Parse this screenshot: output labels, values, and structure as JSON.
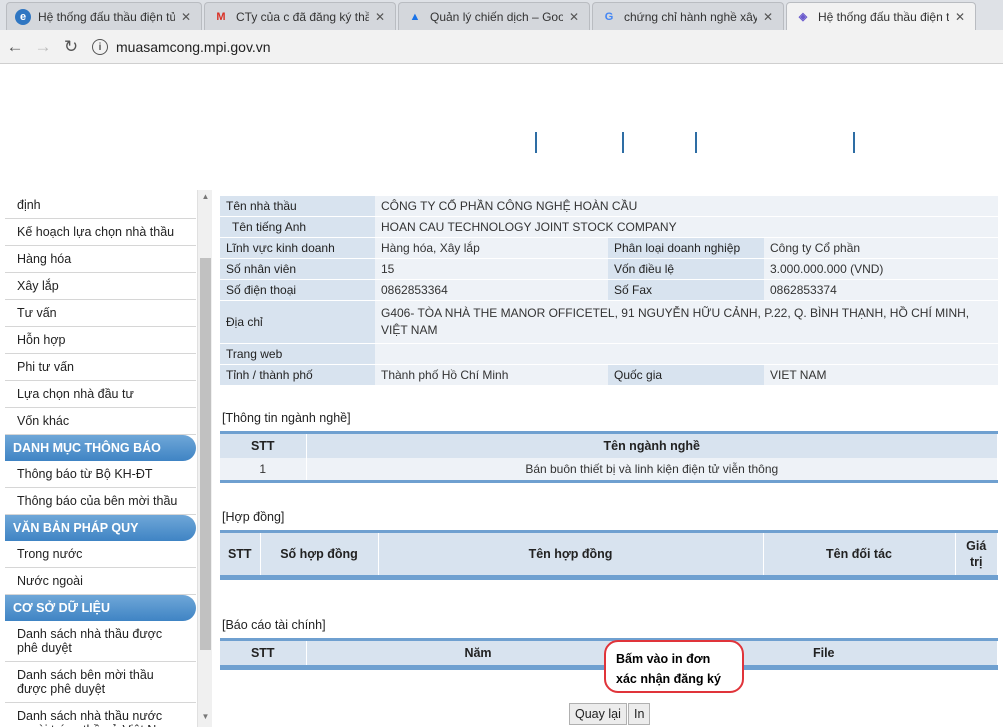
{
  "browser": {
    "tabs": [
      {
        "title": "Hệ thống đấu thầu điện tử",
        "icon": "ie-icon"
      },
      {
        "title": "CTy của c đã đăng ký thầu",
        "icon": "gmail-icon"
      },
      {
        "title": "Quản lý chiến dịch – Google",
        "icon": "google-ads-icon"
      },
      {
        "title": "chứng chỉ hành nghề xây dựng",
        "icon": "google-icon"
      },
      {
        "title": "Hệ thống đấu thầu điện tử",
        "icon": "muasamcong-icon"
      }
    ],
    "url": "muasamcong.mpi.gov.vn"
  },
  "sidebar": {
    "items_top": [
      "định",
      "Kế hoạch lựa chọn nhà thầu",
      "Hàng hóa",
      "Xây lắp",
      "Tư vấn",
      "Hỗn hợp",
      "Phi tư vấn",
      "Lựa chọn nhà đầu tư",
      "Vốn khác"
    ],
    "head_thongbao": "DANH MỤC THÔNG BÁO",
    "items_thongbao": [
      "Thông báo từ Bộ KH-ĐT",
      "Thông báo của bên mời thầu"
    ],
    "head_vanban": "VĂN BẢN PHÁP QUY",
    "items_vanban": [
      "Trong nước",
      "Nước ngoài"
    ],
    "head_csdl": "CƠ SỞ DỮ LIỆU",
    "items_csdl": [
      "Danh sách nhà thầu được phê duyệt",
      "Danh sách bên mời thầu được phê duyệt",
      "Danh sách nhà thầu nước ngoài trúng thầu ở Việt Nam"
    ]
  },
  "company": {
    "name_label": "Tên nhà thầu",
    "name": "CÔNG TY CỔ PHẦN CÔNG NGHỆ HOÀN CẦU",
    "en_label": "Tên tiếng Anh",
    "en_name": "HOAN CAU TECHNOLOGY JOINT STOCK COMPANY",
    "field_label": "Lĩnh vực kinh doanh",
    "field": "Hàng hóa, Xây lắp",
    "type_label": "Phân loại doanh nghiệp",
    "type": "Công ty Cổ phần",
    "staff_label": "Số nhân viên",
    "staff": "15",
    "capital_label": "Vốn điều lệ",
    "capital": "3.000.000.000 (VND)",
    "phone_label": "Số điện thoại",
    "phone": "0862853364",
    "fax_label": "Số Fax",
    "fax": "0862853374",
    "address_label": "Địa chỉ",
    "address": "G406- TÒA NHÀ THE MANOR OFFICETEL, 91 NGUYỄN HỮU CẢNH, P.22, Q. BÌNH THẠNH, HỒ CHÍ MINH, VIỆT NAM",
    "web_label": "Trang web",
    "web": "",
    "province_label": "Tỉnh / thành phố",
    "province": "Thành phố Hồ Chí Minh",
    "country_label": "Quốc gia",
    "country": "VIET NAM"
  },
  "industry": {
    "title": "[Thông tin ngành nghề]",
    "headers": [
      "STT",
      "Tên ngành nghề"
    ],
    "rows": [
      [
        "1",
        "Bán buôn thiết bị và linh kiện điện tử viễn thông"
      ]
    ]
  },
  "contracts": {
    "title": "[Hợp đồng]",
    "headers": [
      "STT",
      "Số hợp đồng",
      "Tên hợp đồng",
      "Tên đối tác",
      "Giá trị"
    ]
  },
  "finance": {
    "title": "[Báo cáo tài chính]",
    "headers": [
      "STT",
      "Năm",
      "File"
    ]
  },
  "callout": "Bấm vào in đơn xác nhận đăng ký",
  "buttons": {
    "back": "Quay lại",
    "print": "In"
  }
}
